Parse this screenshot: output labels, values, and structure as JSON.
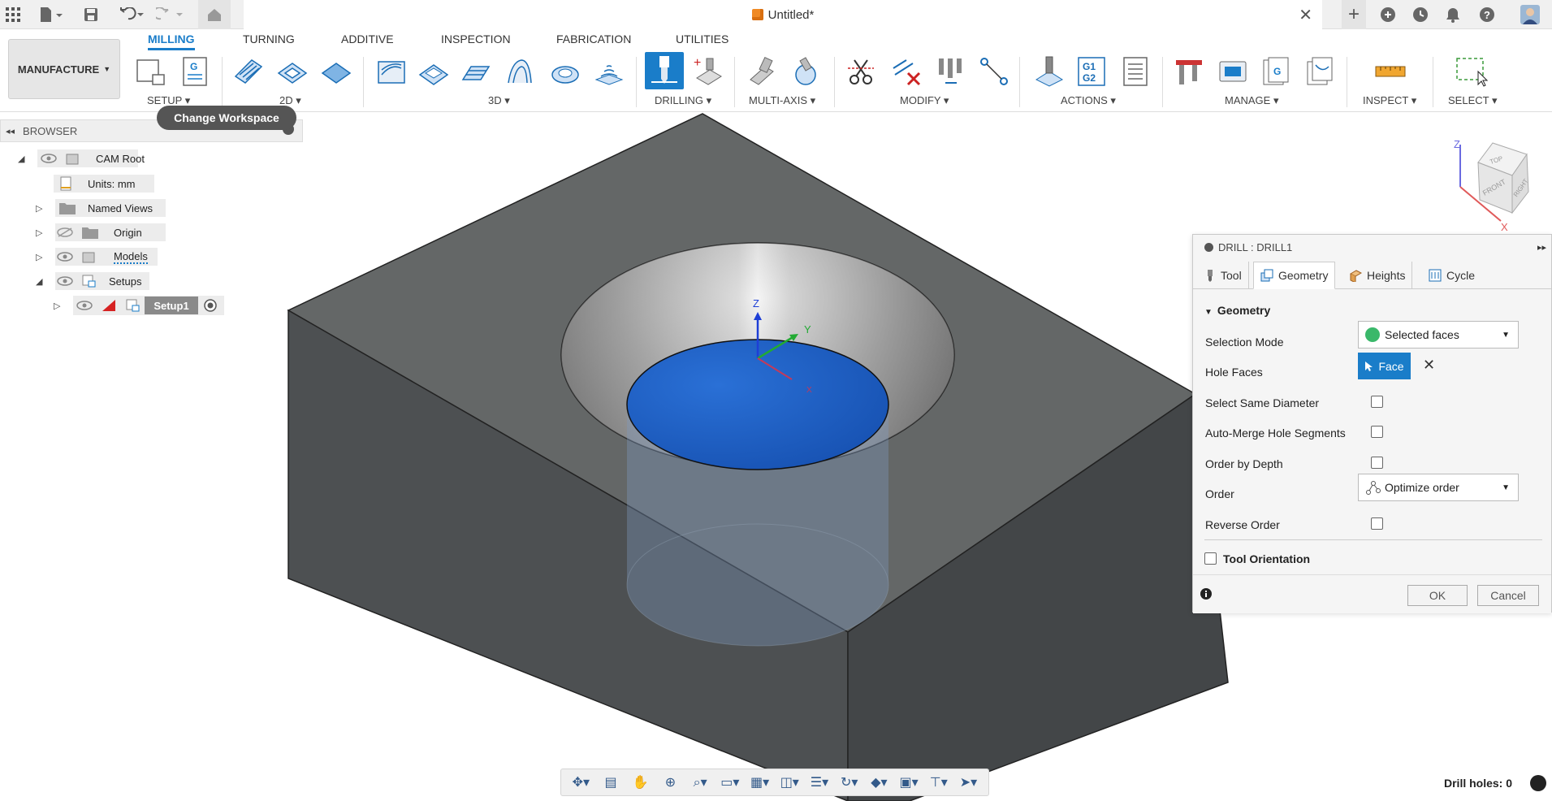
{
  "document": {
    "title": "Untitled*"
  },
  "workspace": {
    "label": "MANUFACTURE",
    "tooltip": "Change Workspace"
  },
  "tabs": [
    "MILLING",
    "TURNING",
    "ADDITIVE",
    "INSPECTION",
    "FABRICATION",
    "UTILITIES"
  ],
  "groups": {
    "setup": "SETUP ▾",
    "twod": "2D ▾",
    "threed": "3D ▾",
    "drilling": "DRILLING ▾",
    "multiaxis": "MULTI-AXIS ▾",
    "modify": "MODIFY ▾",
    "actions": "ACTIONS ▾",
    "manage": "MANAGE ▾",
    "inspect": "INSPECT ▾",
    "select": "SELECT ▾"
  },
  "actions_icon_text": [
    "G1",
    "G2"
  ],
  "browser": {
    "title": "BROWSER",
    "items": [
      {
        "label": "CAM Root"
      },
      {
        "label": "Units: mm"
      },
      {
        "label": "Named Views"
      },
      {
        "label": "Origin"
      },
      {
        "label": "Models"
      },
      {
        "label": "Setups"
      },
      {
        "label": "Setup1"
      }
    ]
  },
  "viewcube": {
    "top": "TOP",
    "front": "FRONT",
    "right": "RIGHT",
    "axis_z": "Z",
    "axis_x": "X"
  },
  "triad": {
    "z": "Z",
    "y": "Y",
    "x": "X"
  },
  "panel": {
    "title": "DRILL : DRILL1",
    "tabs": [
      "Tool",
      "Geometry",
      "Heights",
      "Cycle"
    ],
    "section": "Geometry",
    "selection_mode_label": "Selection Mode",
    "selection_mode_value": "Selected faces",
    "hole_faces_label": "Hole Faces",
    "hole_faces_value": "Face",
    "select_same_diameter": "Select Same Diameter",
    "auto_merge": "Auto-Merge Hole Segments",
    "order_by_depth": "Order by Depth",
    "order_label": "Order",
    "order_value": "Optimize order",
    "reverse_order": "Reverse Order",
    "tool_orientation": "Tool Orientation",
    "ok": "OK",
    "cancel": "Cancel"
  },
  "status": {
    "drill_holes": "Drill holes: 0"
  },
  "colors": {
    "accent": "#1a7dc9",
    "face_blue": "#1f5fc9",
    "body_dark": "#555a5c"
  }
}
